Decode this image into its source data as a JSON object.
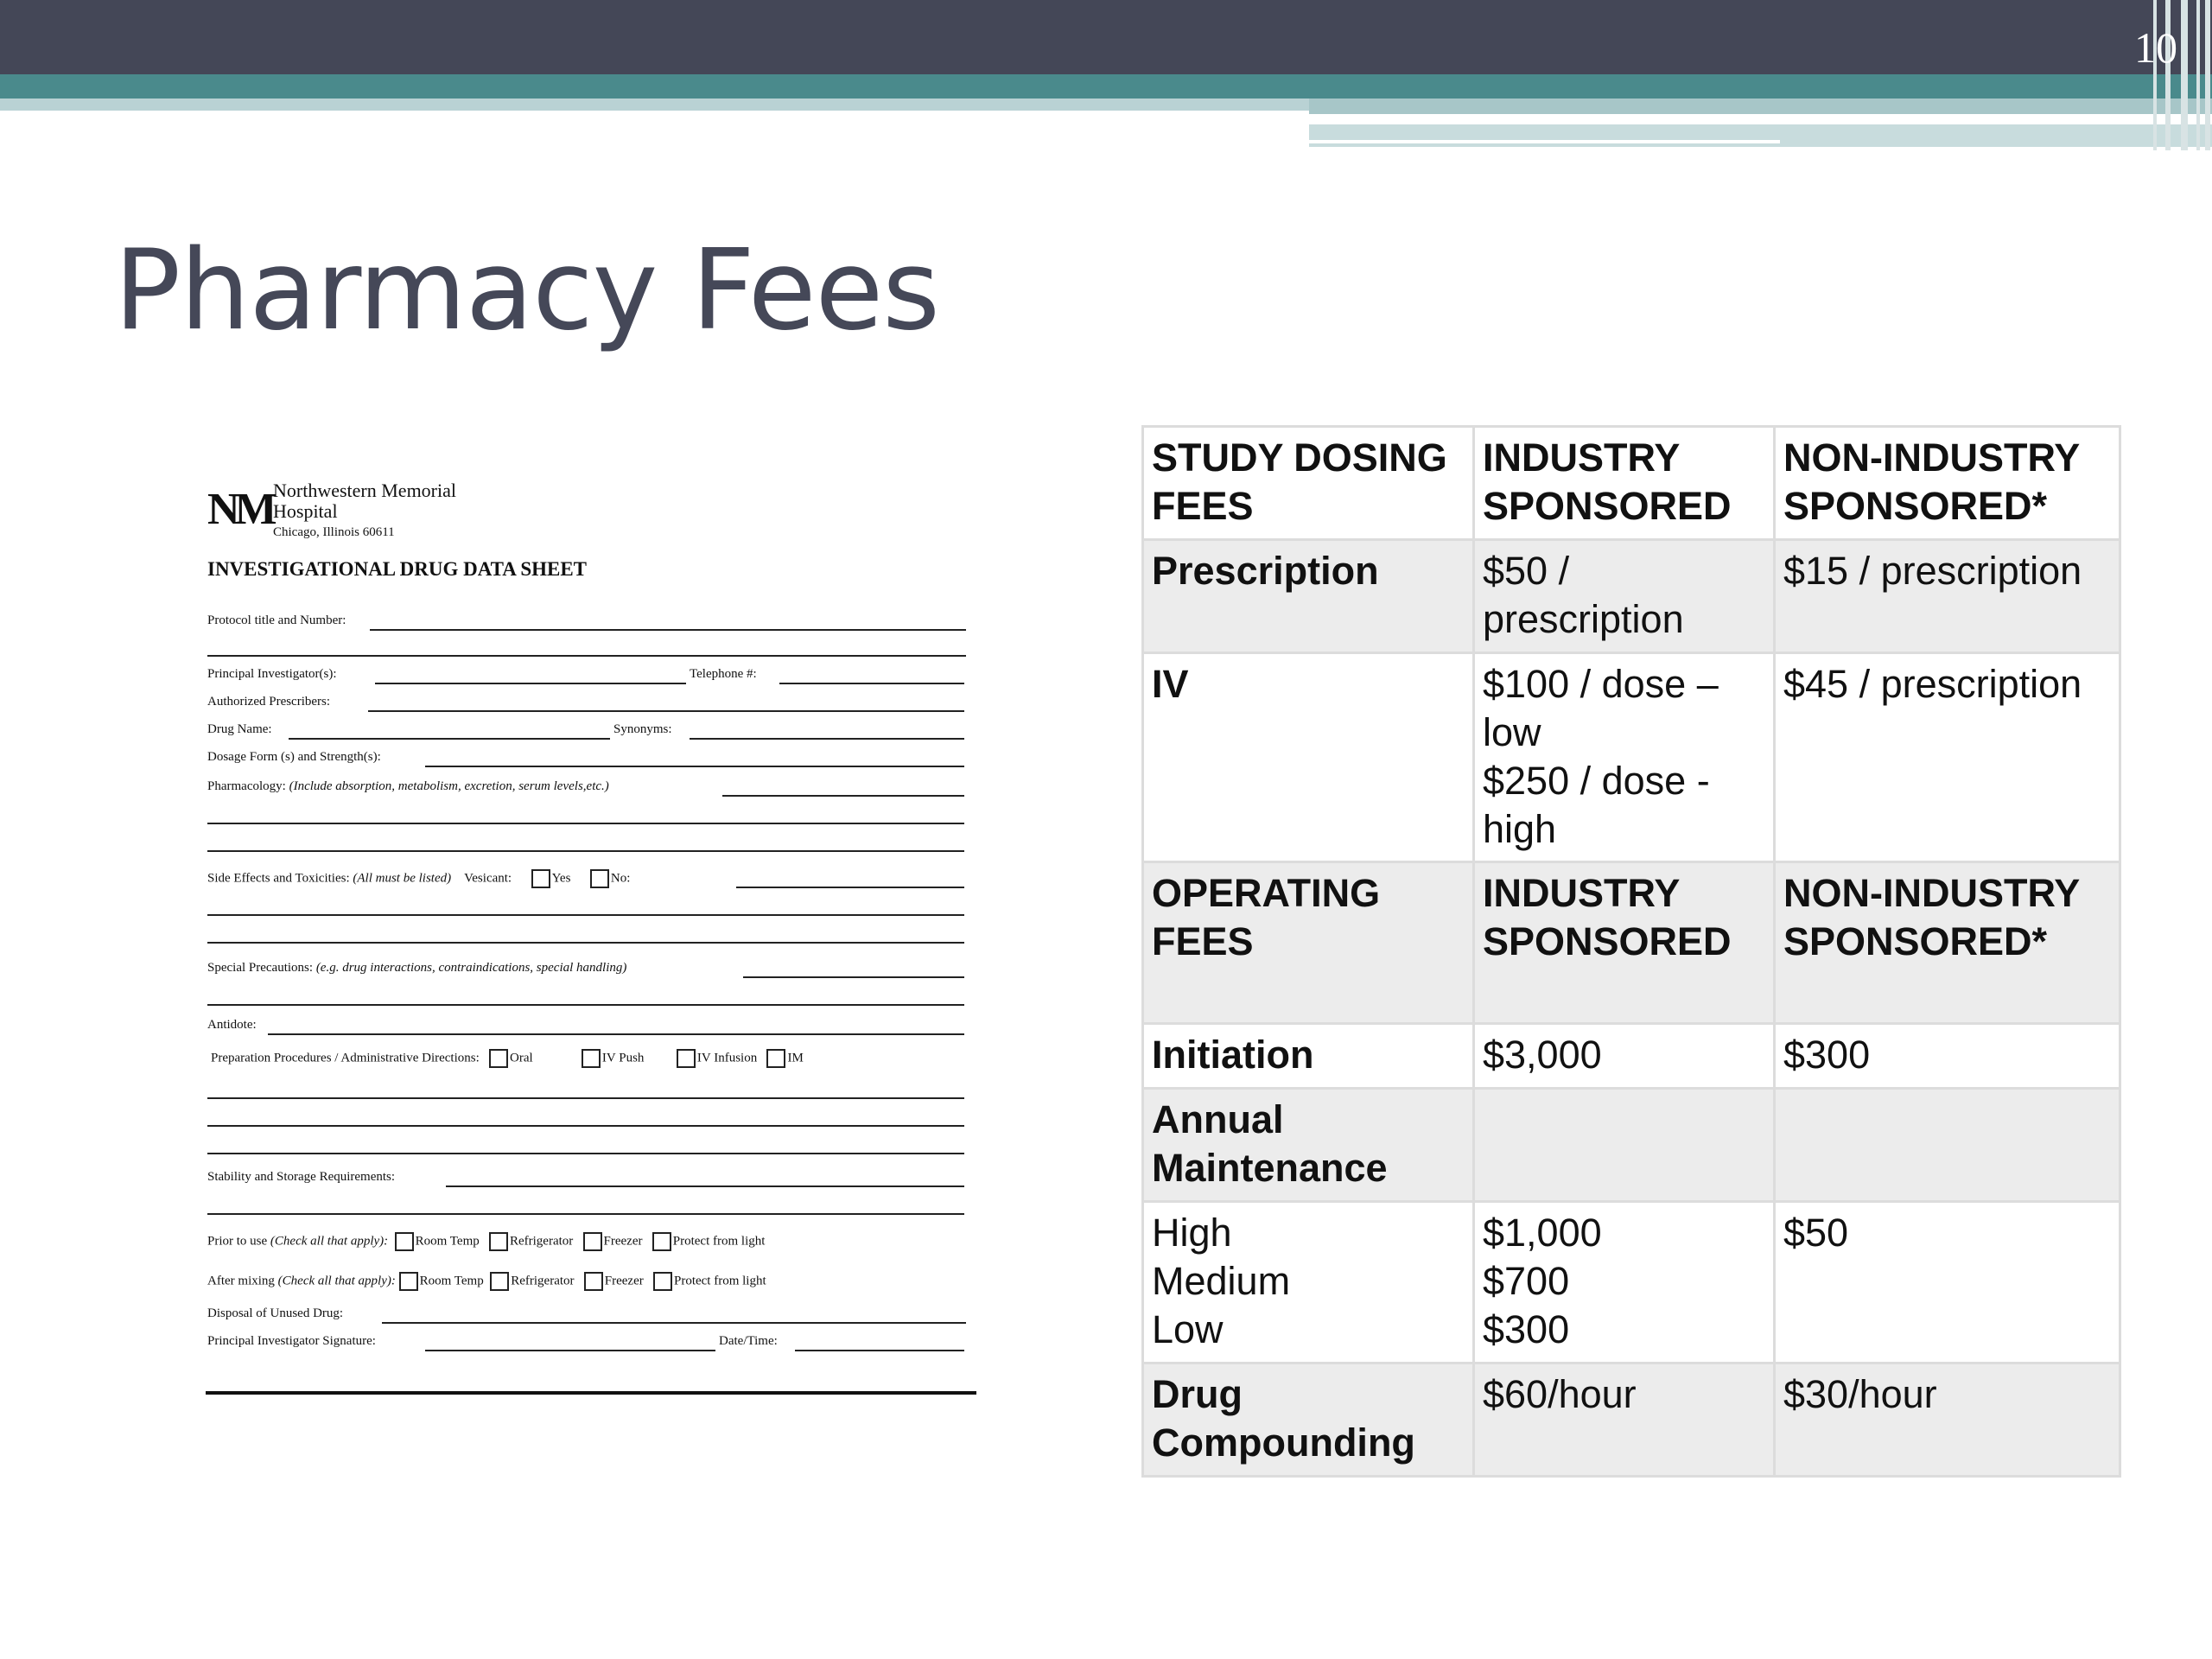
{
  "slide": {
    "number": "10",
    "title": "Pharmacy Fees"
  },
  "form": {
    "logo_mark": "NM",
    "hospital_name": "Northwestern Memorial\nHospital",
    "city": "Chicago, Illinois 60611",
    "sheet_title": "INVESTIGATIONAL DRUG DATA SHEET",
    "protocol": "Protocol title and Number:",
    "principal_investigator": "Principal Investigator(s):",
    "telephone": "Telephone #:",
    "authorized_prescribers": "Authorized Prescribers:",
    "drug_name": "Drug Name:",
    "synonyms": "Synonyms:",
    "dosage_form": "Dosage Form (s) and Strength(s):",
    "pharmacology": "Pharmacology:",
    "pharmacology_note": "(Include absorption, metabolism, excretion, serum levels,etc.)",
    "side_effects": "Side Effects and Toxicities:",
    "side_effects_note": "(All must be listed)",
    "vesicant": "Vesicant:",
    "yes": "Yes",
    "no": "No:",
    "special_precautions": "Special Precautions:",
    "special_precautions_note": "(e.g. drug interactions, contraindications, special handling)",
    "antidote": "Antidote:",
    "preparation": "Preparation Procedures / Administrative Directions:",
    "oral": "Oral",
    "iv_push": "IV Push",
    "iv_infusion": "IV Infusion",
    "im": "IM",
    "stability": "Stability and Storage Requirements:",
    "prior_to_use": "Prior to use",
    "after_mixing": "After mixing",
    "check_all": "(Check all that apply):",
    "room_temp": "Room Temp",
    "refrigerator": "Refrigerator",
    "freezer": "Freezer",
    "protect": "Protect from light",
    "disposal": "Disposal of Unused Drug:",
    "pi_signature": "Principal Investigator Signature:",
    "date_time": "Date/Time:"
  },
  "fees_table": {
    "rows": [
      [
        "STUDY DOSING FEES",
        "INDUSTRY SPONSORED",
        "NON-INDUSTRY SPONSORED*"
      ],
      [
        "Prescription",
        "$50 / prescription",
        "$15 / prescription"
      ],
      [
        "IV",
        "$100 / dose – low\n$250 / dose - high",
        "$45 / prescription"
      ],
      [
        "OPERATING FEES",
        "INDUSTRY SPONSORED",
        "NON-INDUSTRY SPONSORED*"
      ],
      [
        "Initiation",
        "$3,000",
        "$300"
      ],
      [
        "Annual Maintenance",
        "",
        ""
      ],
      [
        "High\nMedium\nLow",
        "$1,000\n$700\n$300",
        "$50"
      ],
      [
        "Drug Compounding",
        "$60/hour",
        "$30/hour"
      ]
    ]
  }
}
